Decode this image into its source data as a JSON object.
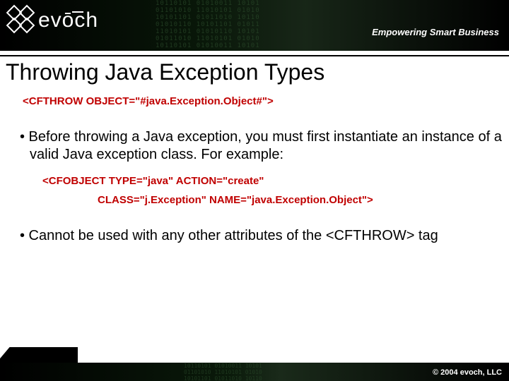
{
  "brand": {
    "name": "evōch",
    "tagline": "Empowering Smart Business"
  },
  "slide": {
    "title": "Throwing Java Exception Types",
    "code_throw": "<CFTHROW OBJECT=\"#java.Exception.Object#\">",
    "bullet1": "• Before throwing a Java exception, you must first instantiate an instance of a valid Java exception class.  For example:",
    "code_obj_line1": "<CFOBJECT TYPE=\"java\" ACTION=\"create\"",
    "code_obj_line2": "CLASS=\"j.Exception\" NAME=\"java.Exception.Object\">",
    "bullet2": "• Cannot be used with any other attributes of the <CFTHROW> tag"
  },
  "footer": {
    "copyright": "© 2004 evoch, LLC"
  },
  "decor": {
    "binary": "10110101 01010011 10101\n01101010 11010101 01010\n10101101 01011010 10110\n01010110 10101101 01011\n11010101 01010110 10101\n01011010 11010101 01010\n10110101 01010011 10101"
  }
}
